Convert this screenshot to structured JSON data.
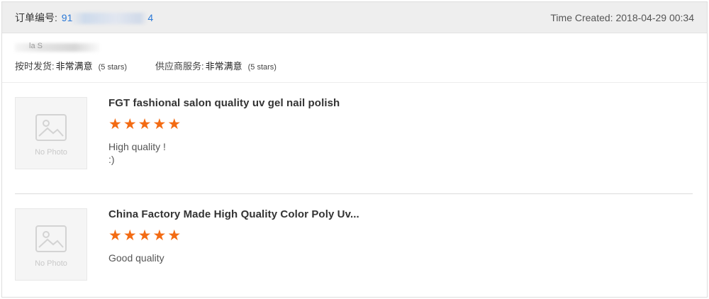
{
  "header": {
    "order_label": "订单编号:",
    "order_id_visible": "91",
    "order_id_tail": "4",
    "time_created": "Time Created: 2018-04-29 00:34"
  },
  "seller": {
    "name_fragment": "la S",
    "on_time_label": "按时发货:",
    "on_time_value": "非常满意",
    "on_time_stars": "(5 stars)",
    "service_label": "供应商服务:",
    "service_value": "非常满意",
    "service_stars": "(5 stars)"
  },
  "colors": {
    "star": "#f36b13",
    "link": "#2a78d6",
    "header_bg": "#eeeeee"
  },
  "items": [
    {
      "title": "FGT fashional salon quality uv gel nail polish",
      "rating": 5,
      "comment_line1": "High quality !",
      "comment_line2": ":)",
      "placeholder": "No Photo",
      "icon": "image-placeholder-icon"
    },
    {
      "title": "China Factory Made High Quality Color Poly Uv...",
      "rating": 5,
      "comment_line1": "Good quality",
      "comment_line2": "",
      "placeholder": "No Photo",
      "icon": "image-placeholder-icon"
    }
  ]
}
